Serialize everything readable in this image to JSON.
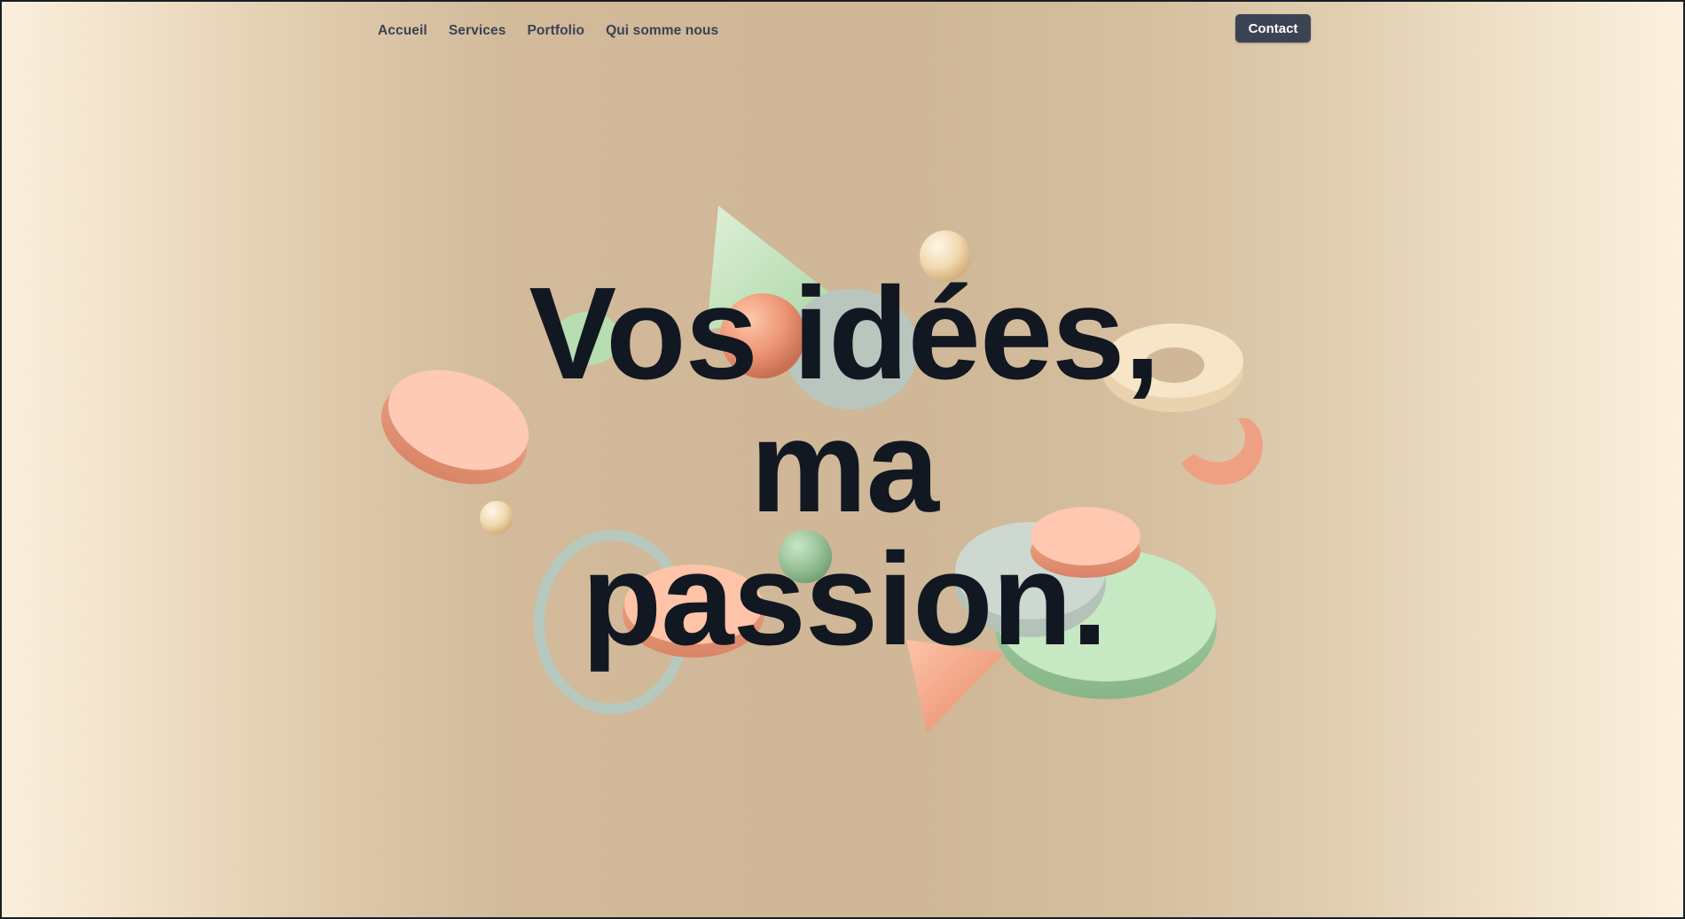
{
  "nav": {
    "items": [
      {
        "label": "Accueil"
      },
      {
        "label": "Services"
      },
      {
        "label": "Portfolio"
      },
      {
        "label": "Qui somme nous"
      }
    ],
    "contact_label": "Contact"
  },
  "hero": {
    "line1": "Vos idées,",
    "line2": "ma",
    "line3": "passion."
  },
  "colors": {
    "background": "#cfb797",
    "heading": "#121822",
    "nav_text": "#3a4354",
    "button": "#3b4453",
    "shape_peach": "#f7b79c",
    "shape_mint": "#bde3bd",
    "shape_sage": "#b9c8bf",
    "shape_cream": "#f4e1c0"
  }
}
